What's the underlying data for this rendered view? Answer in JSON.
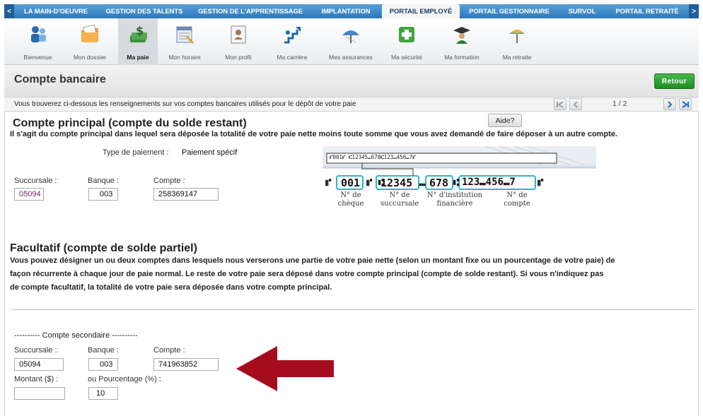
{
  "topnav": {
    "left_arrow": "<",
    "right_arrow": ">",
    "tabs": [
      {
        "label": "LA MAIN-D'OEUVRE"
      },
      {
        "label": "GESTION DES TALENTS"
      },
      {
        "label": "GESTION DE L'APPRENTISSAGE"
      },
      {
        "label": "IMPLANTATION"
      },
      {
        "label": "PORTAIL EMPLOYÉ"
      },
      {
        "label": "PORTAIL GESTIONNAIRE"
      },
      {
        "label": "SURVOL"
      },
      {
        "label": "PORTAIL RETRAITÉ"
      }
    ]
  },
  "iconbar": {
    "items": [
      {
        "label": "Bienvenue",
        "icon": "welcome-icon"
      },
      {
        "label": "Mon dossier",
        "icon": "folder-icon"
      },
      {
        "label": "Ma paie",
        "icon": "money-icon"
      },
      {
        "label": "Mon horaire",
        "icon": "schedule-icon"
      },
      {
        "label": "Mon profil",
        "icon": "profile-icon"
      },
      {
        "label": "Ma carrière",
        "icon": "career-icon"
      },
      {
        "label": "Mes assurances",
        "icon": "insurance-icon"
      },
      {
        "label": "Ma sécurité",
        "icon": "safety-icon"
      },
      {
        "label": "Ma formation",
        "icon": "training-icon"
      },
      {
        "label": "Ma retraite",
        "icon": "retirement-icon"
      }
    ]
  },
  "page": {
    "title": "Compte bancaire",
    "back_label": "Retour",
    "info": "Vous trouverez ci-dessous les renseignements sur vos comptes bancaires utilisés pour le dépôt de votre paie",
    "page_indicator": "1 / 2",
    "help_label": "Aide?"
  },
  "principal": {
    "heading": "Compte principal (compte du solde restant)",
    "description": "Il s'agit du compte principal dans lequel sera déposée la totalité de votre paie nette moins toute somme que vous avez demandé de faire déposer à un autre compte.",
    "payment_type_label": "Type de paiement :",
    "payment_type_value": "Paiement spécif",
    "succursale_label": "Succursale :",
    "banque_label": "Banque :",
    "compte_label": "Compte :",
    "succursale": "05094",
    "banque": "003",
    "compte": "258369147"
  },
  "cheque_image": {
    "micr_small": "⑈001⑈ ⑆12345⑉678⑆123⑉456⑉7⑈",
    "field_cheque": "001",
    "field_succursale": "12345",
    "field_institution": "678",
    "field_compte": "123⑉456⑉7",
    "caption_cheque": "N° de chèque",
    "caption_succursale": "N° de succursale",
    "caption_institution": "N° d'institution financière",
    "caption_compte": "N° de compte",
    "accent_color": "#2bb7c9"
  },
  "facultatif": {
    "heading": "Facultatif (compte de solde partiel)",
    "line1": "Vous pouvez désigner un ou deux comptes dans lesquels nous verserons une partie de votre paie nette (selon un montant fixe ou un pourcentage de votre paie) de",
    "line2": "façon récurrente à chaque jour de paie normal. Le reste de votre paie sera déposé dans votre compte principal (compte de solde restant). Si vous n'indiquez pas",
    "line3": "de compte facultatif, la totalité de votre paie sera déposée dans votre compte principal."
  },
  "secondaire": {
    "heading": "---------- Compte secondaire ----------",
    "succursale_label": "Succursale :",
    "banque_label": "Banque :",
    "compte_label": "Compte :",
    "succursale": "05094",
    "banque": "003",
    "compte": "741963852",
    "montant_label": "Montant ($) :",
    "pourcentage_label": "ou Pourcentage (%) :",
    "montant": "",
    "pourcentage": "10"
  },
  "colors": {
    "nav_blue": "#2f78b8",
    "retour_green": "#1e8d22",
    "arrow_red": "#a50d1f"
  }
}
